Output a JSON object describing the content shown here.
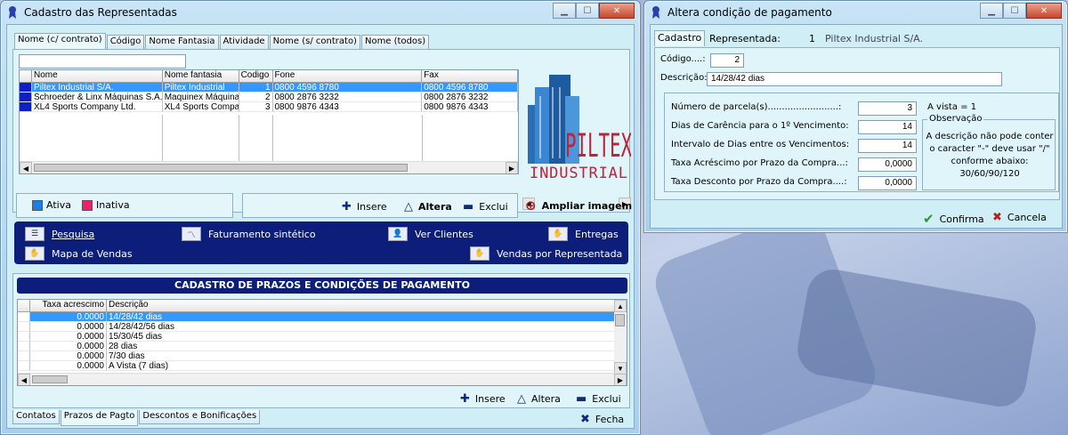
{
  "left_window": {
    "title": "Cadastro das Representadas",
    "search_value": "",
    "tabs": [
      "Nome (c/ contrato)",
      "Código",
      "Nome Fantasia",
      "Atividade",
      "Nome (s/ contrato)",
      "Nome (todos)"
    ],
    "grid": {
      "columns": [
        "Nome",
        "Nome fantasia",
        "Codigo",
        "Fone",
        "Fax"
      ],
      "rows": [
        {
          "nome": "Piltex Industrial S/A.",
          "fantasia": "Piltex Industrial",
          "codigo": "1",
          "fone": "0800 4596 8780",
          "fax": "0800 4596 8780"
        },
        {
          "nome": "Schroeder & Linx Máquinas S.A.",
          "fantasia": "Maquinex Máquinas",
          "codigo": "2",
          "fone": "0800 2876 3232",
          "fax": "0800 2876 3232"
        },
        {
          "nome": "XL4 Sports Company Ltd.",
          "fantasia": "XL4 Sports Compan",
          "codigo": "3",
          "fone": "0800 9876 4343",
          "fax": "0800 9876 4343"
        }
      ]
    },
    "logo": {
      "line1": "PILTEX",
      "line2": "INDUSTRIAL"
    },
    "legend": {
      "ativa": "Ativa",
      "inativa": "Inativa"
    },
    "actions": {
      "insere": "Insere",
      "altera": "Altera",
      "exclui": "Exclui",
      "ampliar": "Ampliar imagem"
    },
    "menu": {
      "pesquisa": "Pesquisa",
      "faturamento": "Faturamento sintético",
      "ver_clientes": "Ver Clientes",
      "entregas": "Entregas",
      "mapa": "Mapa de Vendas",
      "vendas_rep": "Vendas por Representada"
    },
    "prazos": {
      "header": "CADASTRO DE PRAZOS E CONDIÇÕES DE PAGAMENTO",
      "columns": [
        "Taxa acrescimo",
        "Descrição"
      ],
      "rows": [
        {
          "taxa": "0.0000",
          "desc": "14/28/42 dias"
        },
        {
          "taxa": "0.0000",
          "desc": "14/28/42/56 dias"
        },
        {
          "taxa": "0.0000",
          "desc": "15/30/45 dias"
        },
        {
          "taxa": "0.0000",
          "desc": "28 dias"
        },
        {
          "taxa": "0.0000",
          "desc": "7/30 dias"
        },
        {
          "taxa": "0.0000",
          "desc": "A Vista (7 dias)"
        }
      ],
      "actions": {
        "insere": "Insere",
        "altera": "Altera",
        "exclui": "Exclui"
      }
    },
    "bottom_tabs": [
      "Contatos",
      "Prazos de Pagto",
      "Descontos e Bonificações"
    ],
    "fecha": "Fecha"
  },
  "right_window": {
    "title": "Altera condição de pagamento",
    "tab": "Cadastro",
    "representada_label": "Representada:",
    "representada_code": "1",
    "representada_name": "Piltex Industrial S/A.",
    "codigo_label": "Código....:",
    "codigo_value": "2",
    "descricao_label": "Descrição:",
    "descricao_value": "14/28/42 dias",
    "fields": [
      {
        "label": "Número de parcela(s).........................:",
        "value": "3"
      },
      {
        "label": "Dias de Carência para o 1º Vencimento:",
        "value": "14"
      },
      {
        "label": "Intervalo de Dias entre os Vencimentos:",
        "value": "14"
      },
      {
        "label": "Taxa Acréscimo por Prazo da Compra...:",
        "value": "0,0000"
      },
      {
        "label": "Taxa Desconto por Prazo da Compra....:",
        "value": "0,0000"
      }
    ],
    "a_vista": "A vista = 1",
    "observacao_title": "Observação",
    "observacao_text": "A descrição não pode conter o caracter \"-\" deve usar \"/\" conforme abaixo: 30/60/90/120",
    "confirma": "Confirma",
    "cancela": "Cancela"
  }
}
